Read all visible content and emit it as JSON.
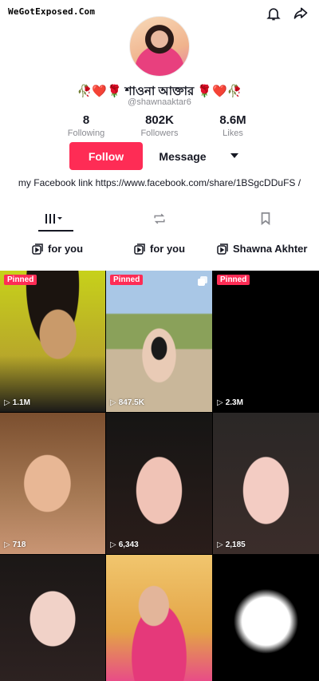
{
  "watermark": "WeGotExposed.Com",
  "profile": {
    "name": "শাওনা আক্তার",
    "name_deco_left": "🥀❤️🌹",
    "name_deco_right": "🌹❤️🥀",
    "handle": "@shawnaaktar6"
  },
  "stats": [
    {
      "value": "8",
      "label": "Following"
    },
    {
      "value": "802K",
      "label": "Followers"
    },
    {
      "value": "8.6M",
      "label": "Likes"
    }
  ],
  "actions": {
    "follow_label": "Follow",
    "message_label": "Message"
  },
  "bio": "my Facebook link https://www.facebook.com/share/1BSgcDDuFS /",
  "playlists": [
    {
      "label": "for you"
    },
    {
      "label": "for you"
    },
    {
      "label": "Shawna Akhter"
    }
  ],
  "videos": [
    {
      "pinned": "Pinned",
      "views": "1.1M"
    },
    {
      "pinned": "Pinned",
      "views": "847.5K"
    },
    {
      "pinned": "Pinned",
      "views": "2.3M"
    },
    {
      "pinned": "",
      "views": "718"
    },
    {
      "pinned": "",
      "views": "6,343"
    },
    {
      "pinned": "",
      "views": "2,185"
    },
    {
      "pinned": "",
      "views": ""
    },
    {
      "pinned": "",
      "views": ""
    },
    {
      "pinned": "",
      "views": ""
    }
  ],
  "colors": {
    "accent": "#fe2c55",
    "text": "#161823",
    "muted": "#8a8b91"
  }
}
